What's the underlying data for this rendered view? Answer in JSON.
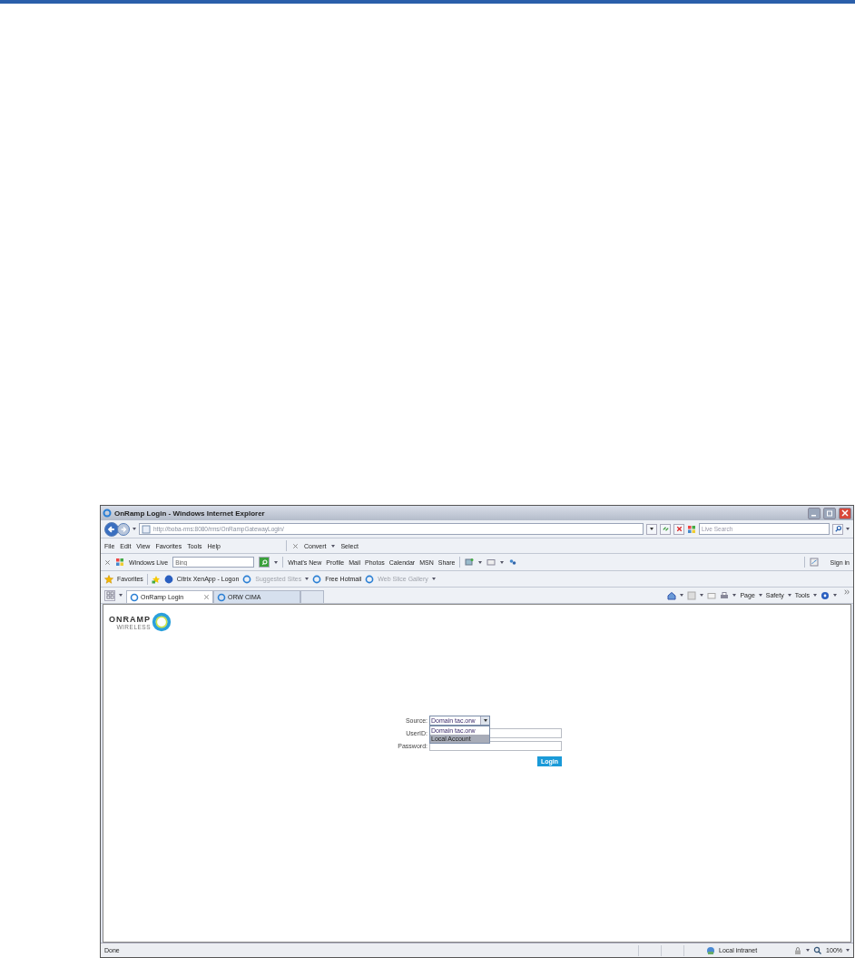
{
  "window": {
    "title": "OnRamp Login - Windows Internet Explorer"
  },
  "address_bar": {
    "url": "http://boba-rms:8080/rms/OnRampGatewayLogin/"
  },
  "search": {
    "placeholder": "Live Search"
  },
  "menu": [
    "File",
    "Edit",
    "View",
    "Favorites",
    "Tools",
    "Help"
  ],
  "command_bar_top": [
    "Convert",
    "Select"
  ],
  "windows_live": {
    "label": "Windows Live",
    "search_value": "Bing",
    "links": [
      "What's New",
      "Profile",
      "Mail",
      "Photos",
      "Calendar",
      "MSN",
      "Share"
    ],
    "sign_in": "Sign in"
  },
  "favorites": {
    "label": "Favorites",
    "links": [
      {
        "label": "Citrix XenApp - Logon",
        "disabled": false,
        "menu": false
      },
      {
        "label": "Suggested Sites",
        "disabled": true,
        "menu": true
      },
      {
        "label": "Free Hotmail",
        "disabled": false,
        "menu": false
      },
      {
        "label": "Web Slice Gallery",
        "disabled": true,
        "menu": true
      }
    ]
  },
  "tabs": [
    {
      "label": "OnRamp Login",
      "selected": true
    },
    {
      "label": "ORW CIMA",
      "selected": false
    }
  ],
  "command_bar": [
    "Page",
    "Safety",
    "Tools"
  ],
  "logo": {
    "name": "ONRAMP",
    "tagline": "WIRELESS"
  },
  "login": {
    "source_label": "Source:",
    "source_value": "Domain tac.orw",
    "options": [
      {
        "label": "Domain tac.orw",
        "selected": false
      },
      {
        "label": "Local Account",
        "selected": true
      }
    ],
    "userid_label": "UserID:",
    "password_label": "Password:",
    "button": "Login"
  },
  "status_bar": {
    "text": "Done",
    "zone": "Local intranet",
    "zoom": "100%"
  }
}
